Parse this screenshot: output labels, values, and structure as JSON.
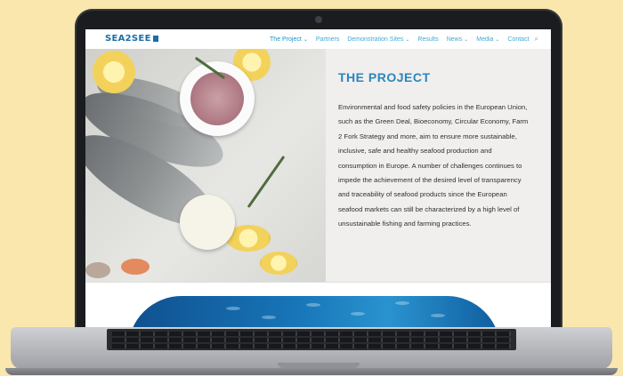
{
  "nav": {
    "logo": "SEA2SEE",
    "items": [
      {
        "label": "The Project",
        "has_dropdown": true,
        "active": true
      },
      {
        "label": "Partners",
        "has_dropdown": false,
        "active": false
      },
      {
        "label": "Demonstration Sites",
        "has_dropdown": true,
        "active": false
      },
      {
        "label": "Results",
        "has_dropdown": false,
        "active": false
      },
      {
        "label": "News",
        "has_dropdown": true,
        "active": false
      },
      {
        "label": "Media",
        "has_dropdown": true,
        "active": false
      },
      {
        "label": "Contact",
        "has_dropdown": false,
        "active": false
      }
    ],
    "search_icon": "search-icon"
  },
  "hero": {
    "title": "THE PROJECT",
    "paragraph": "Environmental and food safety policies in the European Union, such as the Green Deal, Bioeconomy, Circular Economy, Farm 2 Fork Strategy and more, aim to ensure more sustainable, inclusive, safe and healthy seafood production and consumption in Europe. A number of challenges continues to impede the achievement of the desired level of transparency and traceability of seafood products since the European seafood markets can still be characterized by a high level of unsustainable fishing and farming practices.",
    "image_subject": "seafood-photo"
  },
  "colors": {
    "background": "#f9e7ad",
    "accent": "#2a86bb",
    "nav_link": "#3fa9d6"
  }
}
